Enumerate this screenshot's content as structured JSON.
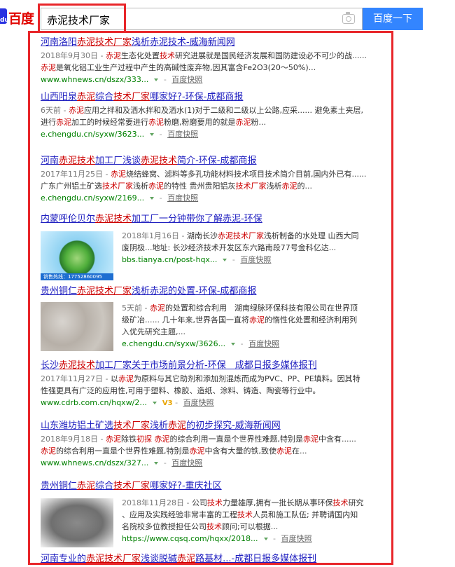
{
  "search": {
    "logo_text": "百度",
    "logo_sub": "du",
    "query": "赤泥技术厂家",
    "button_label": "百度一下"
  },
  "colors": {
    "accent": "#3385ff",
    "highlight_box": "#e8262a",
    "title_link": "#2020c0",
    "keyword": "#cc0000",
    "url": "#008000"
  },
  "results": [
    {
      "title": [
        [
          "河南洛阳",
          0
        ],
        [
          "赤泥技术厂家",
          1
        ],
        [
          "浅析赤泥技术-威海新闻网",
          0
        ]
      ],
      "lines": [
        [
          [
            "2018年9月30日 - ",
            2
          ],
          [
            "赤泥",
            1
          ],
          [
            "生态化处置",
            0
          ],
          [
            "技术",
            1
          ],
          [
            "研究进展就是国民经济发展和国防建设必不可少的战......",
            0
          ]
        ],
        [
          [
            "赤泥",
            1
          ],
          [
            "是氧化铝工业生产过程中产生的高碱性废弃物,因其富含Fe2O3(20～50%)...",
            0
          ]
        ]
      ],
      "url": "www.whnews.cn/dszx/333...",
      "cache": "百度快照"
    },
    {
      "title": [
        [
          "山西阳泉",
          0
        ],
        [
          "赤泥",
          1
        ],
        [
          "综合",
          0
        ],
        [
          "技术厂家",
          1
        ],
        [
          "哪家好?-环保-成都商报",
          0
        ]
      ],
      "lines": [
        [
          [
            "6天前 - ",
            2
          ],
          [
            "赤泥",
            1
          ],
          [
            "应用之拌和及洒水拌和及洒水(1)对于二级和二级以上公路,应采...... 避免素土夹层,",
            0
          ]
        ],
        [
          [
            "进行",
            0
          ],
          [
            "赤泥",
            1
          ],
          [
            "加工的时候经常要进行",
            0
          ],
          [
            "赤泥",
            1
          ],
          [
            "粉磨,粉磨要用的就是",
            0
          ],
          [
            "赤泥",
            1
          ],
          [
            "粉...",
            0
          ]
        ]
      ],
      "url": "e.chengdu.cn/syxw/3623...",
      "cache": "百度快照"
    },
    {
      "title": [
        [
          "河南",
          0
        ],
        [
          "赤泥技术",
          1
        ],
        [
          "加工厂浅谈",
          0
        ],
        [
          "赤泥技术",
          1
        ],
        [
          "简介-环保-成都商报",
          0
        ]
      ],
      "lines": [
        [
          [
            "2017年11月25日 - ",
            2
          ],
          [
            "赤泥",
            1
          ],
          [
            "烧结蜂窝、滤料等多孔功能材料技术项目技术简介目前,国内外已有......",
            0
          ]
        ],
        [
          [
            "广东广州铝土矿选",
            0
          ],
          [
            "技术厂家",
            1
          ],
          [
            "浅析",
            0
          ],
          [
            "赤泥",
            1
          ],
          [
            "的特性 贵州贵阳铝灰",
            0
          ],
          [
            "技术厂家",
            1
          ],
          [
            "浅析",
            0
          ],
          [
            "赤泥",
            1
          ],
          [
            "的...",
            0
          ]
        ]
      ],
      "url": "e.chengdu.cn/syxw/2169...",
      "cache": "百度快照"
    },
    {
      "title": [
        [
          "内蒙呼伦贝尔",
          0
        ],
        [
          "赤泥技术",
          1
        ],
        [
          "加工厂一分钟带你了解赤泥-环保",
          0
        ]
      ],
      "lines": [
        [
          [
            "2018年1月16日 - ",
            2
          ],
          [
            "湖南长沙",
            0
          ],
          [
            "赤泥技术厂家",
            1
          ],
          [
            "浅析制备的水处理 山西大同",
            0
          ]
        ],
        [
          [
            "废阴极...地址: 长沙经济技术开发区东六路南段77号金科亿达...",
            0
          ]
        ]
      ],
      "url": "bbs.tianya.cn/post-hqx...",
      "cache": "百度快照",
      "thumb_caption": "销售热线：17752860095"
    },
    {
      "title": [
        [
          "贵州铜仁",
          0
        ],
        [
          "赤泥技术厂家",
          1
        ],
        [
          "浅析赤泥的处置-环保-成都商报",
          0
        ]
      ],
      "lines": [
        [
          [
            "5天前 - ",
            2
          ],
          [
            "赤泥",
            1
          ],
          [
            "的处置和综合利用　湖南绿脉环保科技有限公司在世界顶",
            0
          ]
        ],
        [
          [
            "级矿冶...... 几十年来,世界各国一直将",
            0
          ],
          [
            "赤泥",
            1
          ],
          [
            "的惰性化处置和经济利用列",
            0
          ]
        ],
        [
          [
            "入优先研究主题,...",
            0
          ]
        ]
      ],
      "url": "e.chengdu.cn/syxw/3626...",
      "cache": "百度快照"
    },
    {
      "title": [
        [
          "长沙",
          0
        ],
        [
          "赤泥技术",
          1
        ],
        [
          "加工厂家",
          0
        ],
        [
          "关于市场前景分析-环保　成都日报多媒体报刊",
          0
        ]
      ],
      "lines": [
        [
          [
            "2017年11月27日 - ",
            2
          ],
          [
            "以",
            0
          ],
          [
            "赤泥",
            1
          ],
          [
            "为原料与其它助剂和添加剂混炼而成为PVC、PP、PE填料。因其特",
            0
          ]
        ],
        [
          [
            "性强更具有广泛的应用性,可用于塑料、橡胶、造纸、涂料、铸造、陶瓷等行业中。",
            0
          ]
        ]
      ],
      "url": "www.cdrb.com.cn/hqxw/2...",
      "v3": "V3",
      "cache": "百度快照"
    },
    {
      "title": [
        [
          "山东潍坊铝土矿选",
          0
        ],
        [
          "技术厂家",
          1
        ],
        [
          "浅析",
          0
        ],
        [
          "赤泥",
          1
        ],
        [
          "的初步探究-威海新闻网",
          0
        ]
      ],
      "lines": [
        [
          [
            "2018年9月18日 - ",
            2
          ],
          [
            "赤泥",
            1
          ],
          [
            "除铁",
            0
          ],
          [
            "初探",
            1
          ],
          [
            " ",
            0
          ],
          [
            "赤泥",
            1
          ],
          [
            "的综合利用一直是个世界性难题,特别是",
            0
          ],
          [
            "赤泥",
            1
          ],
          [
            "中含有......",
            0
          ]
        ],
        [
          [
            "赤泥",
            1
          ],
          [
            "的综合利用一直是个世界性难题,特别是",
            0
          ],
          [
            "赤泥",
            1
          ],
          [
            "中含有大量的铁,致使",
            0
          ],
          [
            "赤泥",
            1
          ],
          [
            "在...",
            0
          ]
        ]
      ],
      "url": "www.whnews.cn/dszx/327...",
      "cache": "百度快照"
    },
    {
      "title": [
        [
          "贵州铜仁",
          0
        ],
        [
          "赤泥",
          1
        ],
        [
          "综合",
          0
        ],
        [
          "技术厂家",
          1
        ],
        [
          "哪家好?-重庆社区",
          0
        ]
      ],
      "lines": [
        [
          [
            "2018年11月28日 - ",
            2
          ],
          [
            "公司",
            0
          ],
          [
            "技术",
            1
          ],
          [
            "力量雄厚,拥有一批长期从事环保",
            0
          ],
          [
            "技术",
            1
          ],
          [
            "研究",
            0
          ]
        ],
        [
          [
            "、应用及实践经验非常丰富的工程",
            0
          ],
          [
            "技术",
            1
          ],
          [
            "人员和施工队伍; 并聘请国内知",
            0
          ]
        ],
        [
          [
            "名院校多位教授担任公司",
            0
          ],
          [
            "技术",
            1
          ],
          [
            "顾问;可以根据...",
            0
          ]
        ]
      ],
      "url": "https://www.cqsq.com/hqxx/2018...",
      "cache": "百度快照"
    },
    {
      "title": [
        [
          "河南专业的",
          0
        ],
        [
          "赤泥技术厂家",
          1
        ],
        [
          "浅谈脱碱",
          0
        ],
        [
          "赤泥",
          1
        ],
        [
          "路基材...-成都日报多媒体报刊",
          0
        ]
      ]
    }
  ]
}
